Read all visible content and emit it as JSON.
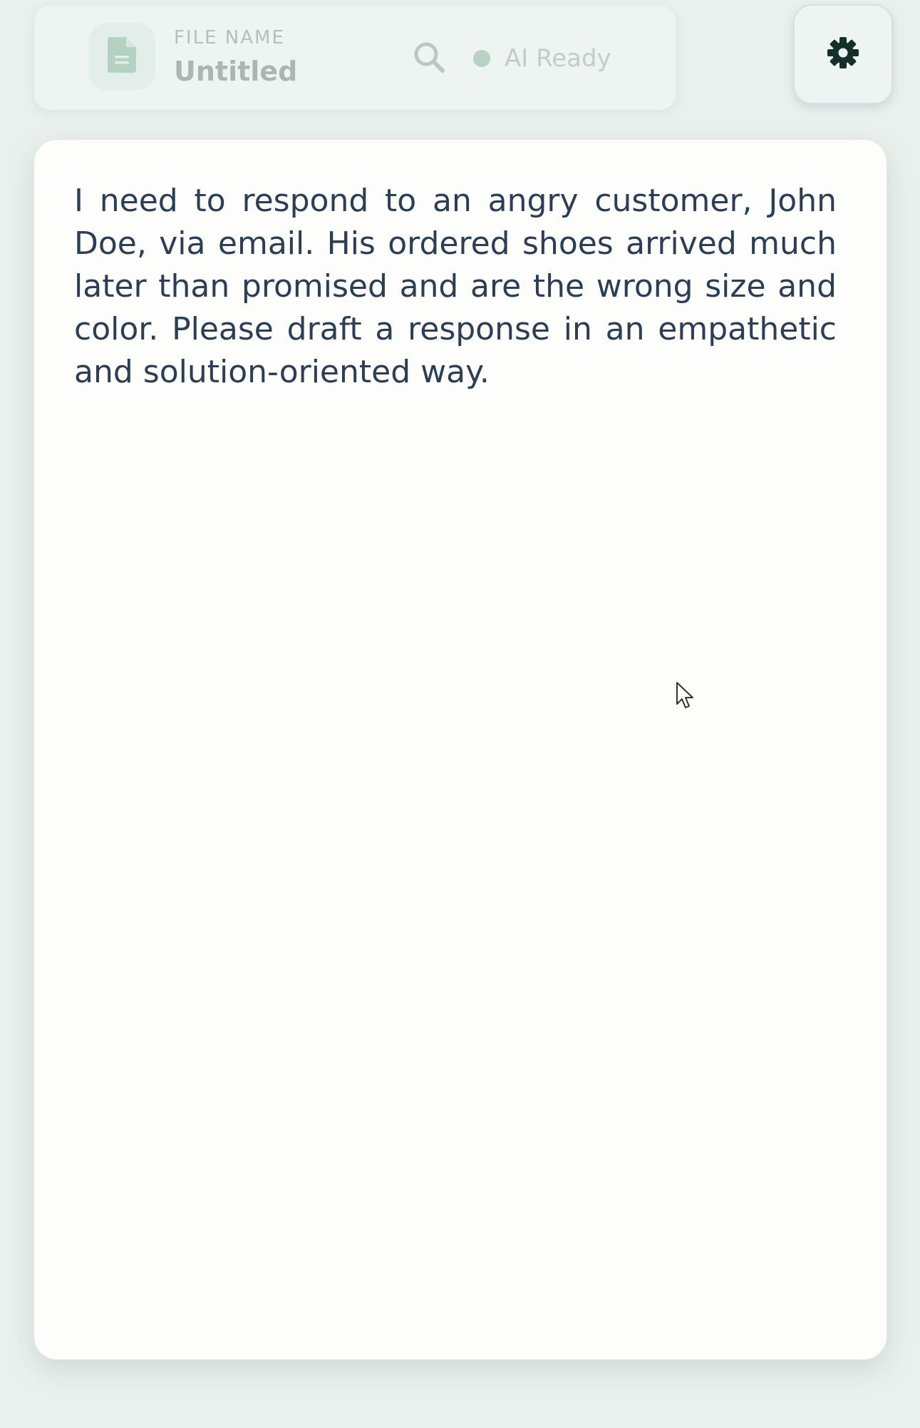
{
  "header": {
    "file_label": "FILE NAME",
    "file_name": "Untitled",
    "status_text": "AI Ready",
    "icons": {
      "file": "file-text-icon",
      "search": "search-icon",
      "settings": "gear-icon"
    }
  },
  "editor": {
    "content": "I need to respond to an angry customer, John Doe, via email. His ordered shoes arrived much later than promised and are the wrong size and color. Please draft a response in an empathetic and solution-oriented way."
  },
  "colors": {
    "background": "#e9f0ee",
    "panel": "#eef4f2",
    "editor_bg": "#fdfefb",
    "text": "#2c3e56",
    "status_dot": "#b9d2c6",
    "settings_icon": "#163029"
  }
}
